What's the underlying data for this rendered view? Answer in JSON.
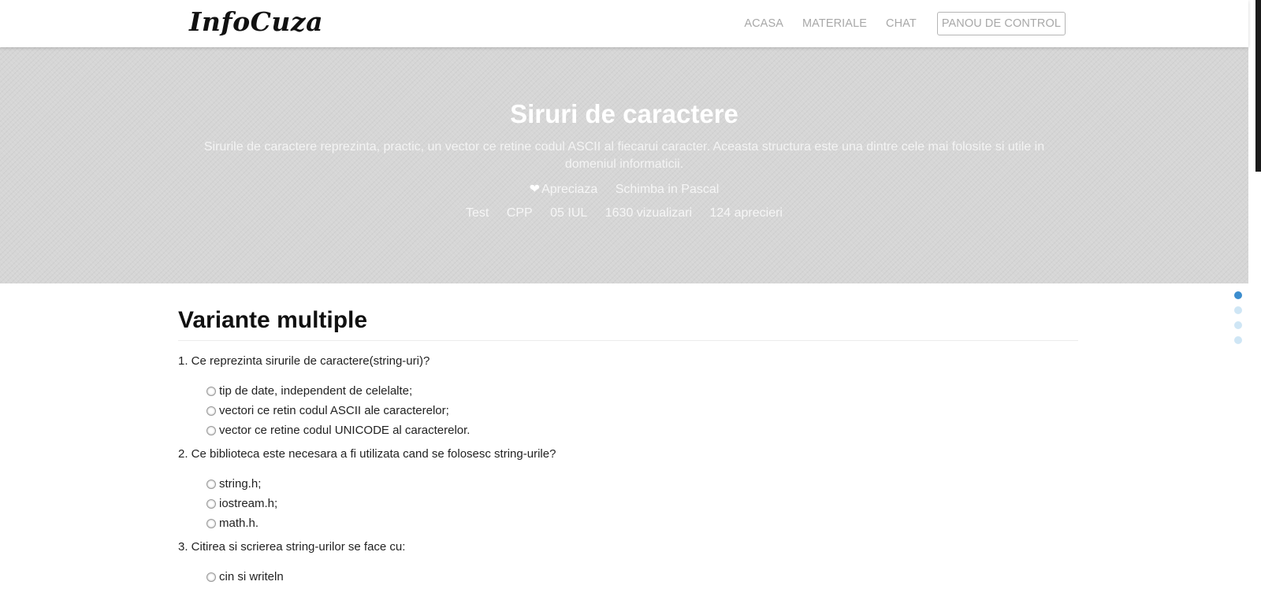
{
  "brand": "InfoCuza",
  "nav": {
    "items": [
      "ACASA",
      "MATERIALE",
      "CHAT"
    ],
    "panel": "PANOU DE CONTROL"
  },
  "hero": {
    "title": "Siruri de caractere",
    "description": "Sirurile de caractere reprezinta, practic, un vector ce retine codul ASCII al fiecarui caracter. Aceasta structura este una dintre cele mai folosite si utile in domeniul informaticii.",
    "like_label": "Apreciaza",
    "switch_label": "Schimba in Pascal",
    "meta": [
      "Test",
      "CPP",
      "05 IUL",
      "1630 vizualizari",
      "124 aprecieri"
    ]
  },
  "section": {
    "title": "Variante multiple"
  },
  "questions": [
    {
      "text": "1. Ce reprezinta sirurile de caractere(string-uri)?",
      "options": [
        "tip de date, independent de celelalte;",
        "vectori ce retin codul ASCII ale caracterelor;",
        "vector ce retine codul UNICODE al caracterelor."
      ]
    },
    {
      "text": "2. Ce biblioteca este necesara a fi utilizata cand se folosesc string-urile?",
      "options": [
        "string.h;",
        "iostream.h;",
        "math.h."
      ]
    },
    {
      "text": "3. Citirea si scrierea string-urilor se face cu:",
      "options": [
        "cin si writeln"
      ]
    }
  ],
  "dot_nav": {
    "count": 4,
    "active_index": 0
  },
  "colors": {
    "hero_bg": "#d6d6d6",
    "dot_active": "#3c8dce",
    "dot_inactive": "#cfe6f5"
  }
}
